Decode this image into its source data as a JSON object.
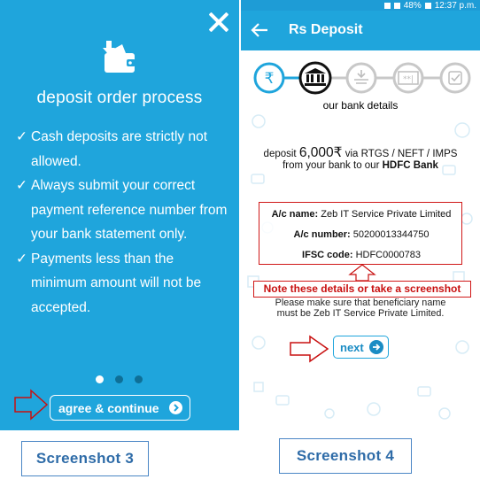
{
  "left": {
    "title": "deposit order process",
    "rules": [
      {
        "tick": "✓",
        "text": "Cash deposits are strictly not allowed."
      },
      {
        "tick": "✓",
        "text": "Always submit your correct payment reference number from your bank statement only."
      },
      {
        "tick": "✓",
        "text": "Payments less than the minimum amount will not be accepted."
      }
    ],
    "pager": {
      "pages": 3,
      "active": 1
    },
    "agree_label": "agree & continue",
    "caption": "Screenshot 3",
    "colors": {
      "background": "#1fa5dc",
      "text": "#ffffff"
    }
  },
  "right": {
    "status": {
      "battery": "48%",
      "time": "12:37 p.m."
    },
    "appbar_title": "Rs Deposit",
    "steps": {
      "active": 2,
      "icons": [
        "rupee-icon",
        "bank-icon",
        "deposit-icon",
        "password-icon",
        "check-icon"
      ]
    },
    "step_caption": "our bank details",
    "deposit": {
      "prefix": "deposit",
      "amount": "6,000₹",
      "suffix": "via RTGS / NEFT / IMPS",
      "line2_prefix": "from your bank to our",
      "bank": "HDFC Bank"
    },
    "bank_details": {
      "name_label": "A/c name:",
      "name_value": "Zeb IT Service Private Limited",
      "number_label": "A/c number:",
      "number_value": "50200013344750",
      "ifsc_label": "IFSC code:",
      "ifsc_value": "HDFC0000783"
    },
    "note": "Note these details or take a screenshot",
    "please_line1": "Please make sure that beneficiary name",
    "please_line2": "must be Zeb IT Service Private Limited.",
    "next_label": "next",
    "caption": "Screenshot 4",
    "colors": {
      "accent": "#1fa5dc",
      "annotation": "#d01818"
    }
  }
}
